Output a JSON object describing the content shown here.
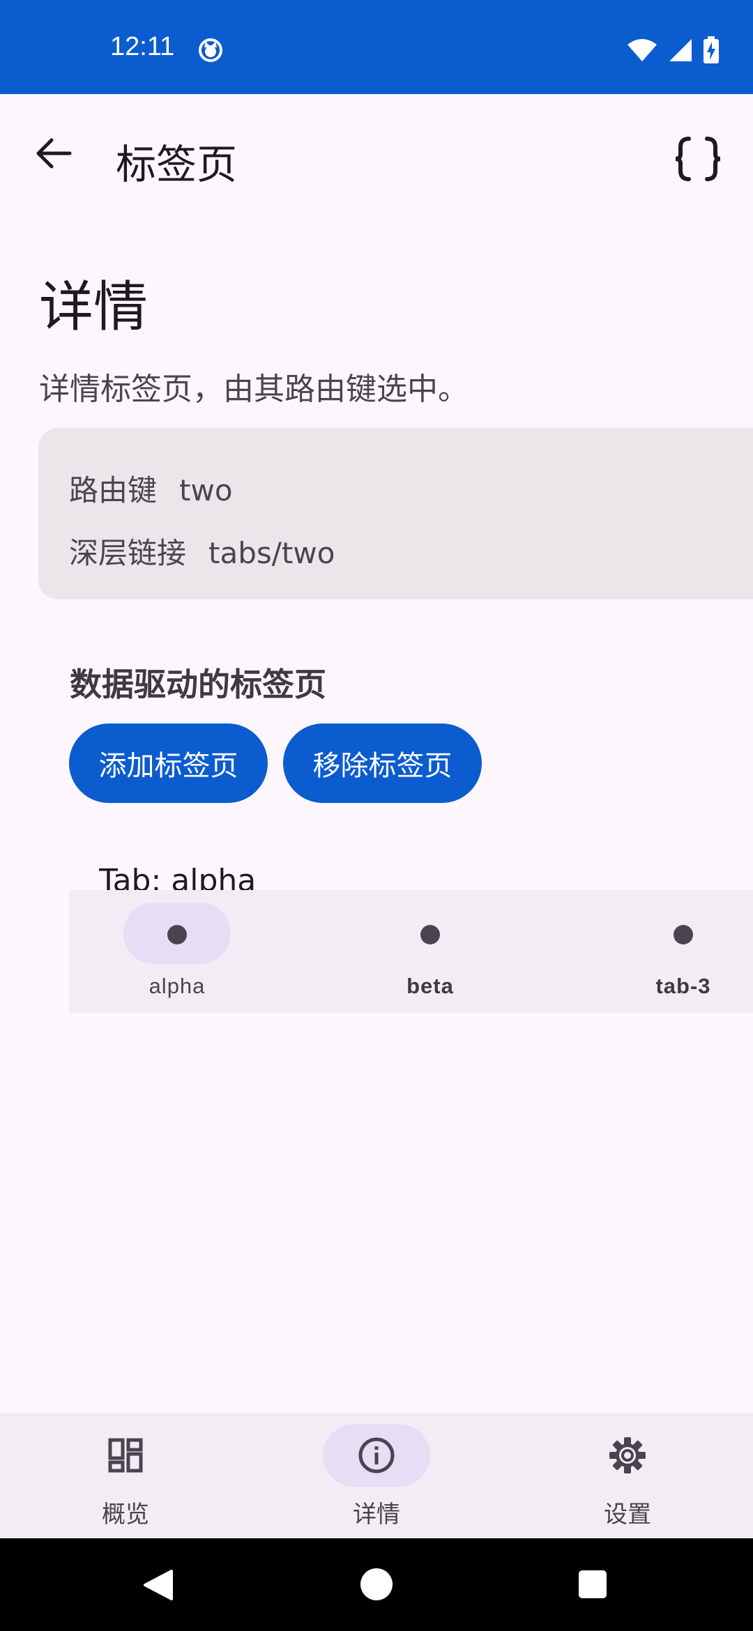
{
  "status_bar": {
    "time": "12:11"
  },
  "app_bar": {
    "title": "标签页"
  },
  "page": {
    "heading": "详情",
    "description": "详情标签页，由其路由键选中。"
  },
  "info": {
    "route_key_label": "路由键",
    "route_key_value": "two",
    "deep_link_label": "深层链接",
    "deep_link_value": "tabs/two"
  },
  "data_tabs": {
    "section_title": "数据驱动的标签页",
    "add_label": "添加标签页",
    "remove_label": "移除标签页",
    "content": "Tab: alpha",
    "tabs": [
      {
        "label": "alpha",
        "selected": true
      },
      {
        "label": "beta",
        "selected": false
      },
      {
        "label": "tab-3",
        "selected": false
      }
    ]
  },
  "bottom_nav": [
    {
      "label": "概览",
      "icon": "dashboard-icon",
      "selected": false
    },
    {
      "label": "详情",
      "icon": "info-icon",
      "selected": true
    },
    {
      "label": "设置",
      "icon": "settings-icon",
      "selected": false
    }
  ],
  "colors": {
    "primary": "#0B5CCF",
    "background": "#FDF7FD",
    "surface_container": "#ECE6EB",
    "indicator": "#E6DEF4"
  }
}
